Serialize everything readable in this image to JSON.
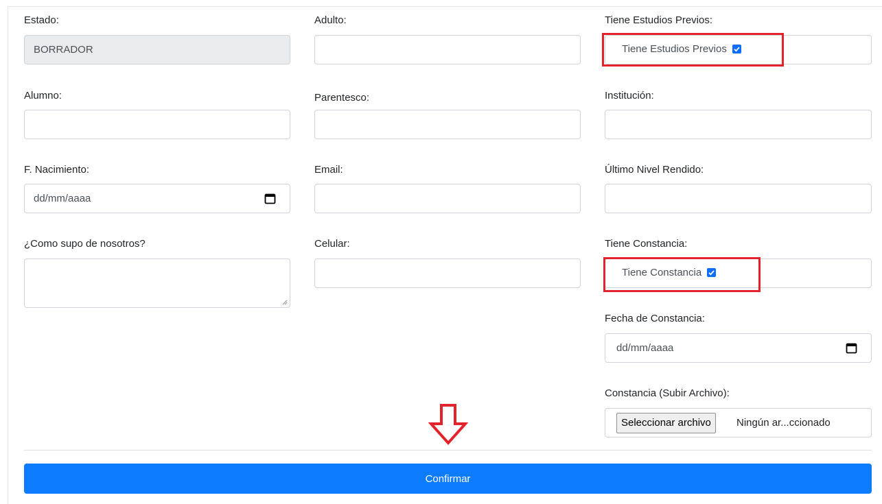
{
  "col1": {
    "estado_label": "Estado:",
    "estado_value": "BORRADOR",
    "alumno_label": "Alumno:",
    "nacimiento_label": "F. Nacimiento:",
    "nacimiento_placeholder": "dd/mm/aaaa",
    "como_supo_label": "¿Como supo de nosotros?"
  },
  "col2": {
    "adulto_label": "Adulto:",
    "parentesco_label": "Parentesco:",
    "email_label": "Email:",
    "celular_label": "Celular:"
  },
  "col3": {
    "estudios_previos_label": "Tiene Estudios Previos:",
    "estudios_previos_check_label": "Tiene Estudios Previos",
    "estudios_previos_checked": true,
    "institucion_label": "Institución:",
    "ultimo_nivel_label": "Último Nivel Rendido:",
    "constancia_label": "Tiene Constancia:",
    "constancia_check_label": "Tiene Constancia",
    "constancia_checked": true,
    "fecha_constancia_label": "Fecha de Constancia:",
    "fecha_constancia_placeholder": "dd/mm/aaaa",
    "subir_archivo_label": "Constancia (Subir Archivo):",
    "file_button_label": "Seleccionar archivo",
    "file_status": "Ningún ar...ccionado"
  },
  "actions": {
    "confirm_label": "Confirmar"
  },
  "icons": {
    "calendar": "calendar-icon",
    "down_arrow": "arrow-down-icon",
    "checkbox": "checkbox-checked-icon"
  },
  "colors": {
    "primary": "#0d7bfd",
    "highlight": "#e3232b",
    "readonly_bg": "#e9ecef"
  }
}
